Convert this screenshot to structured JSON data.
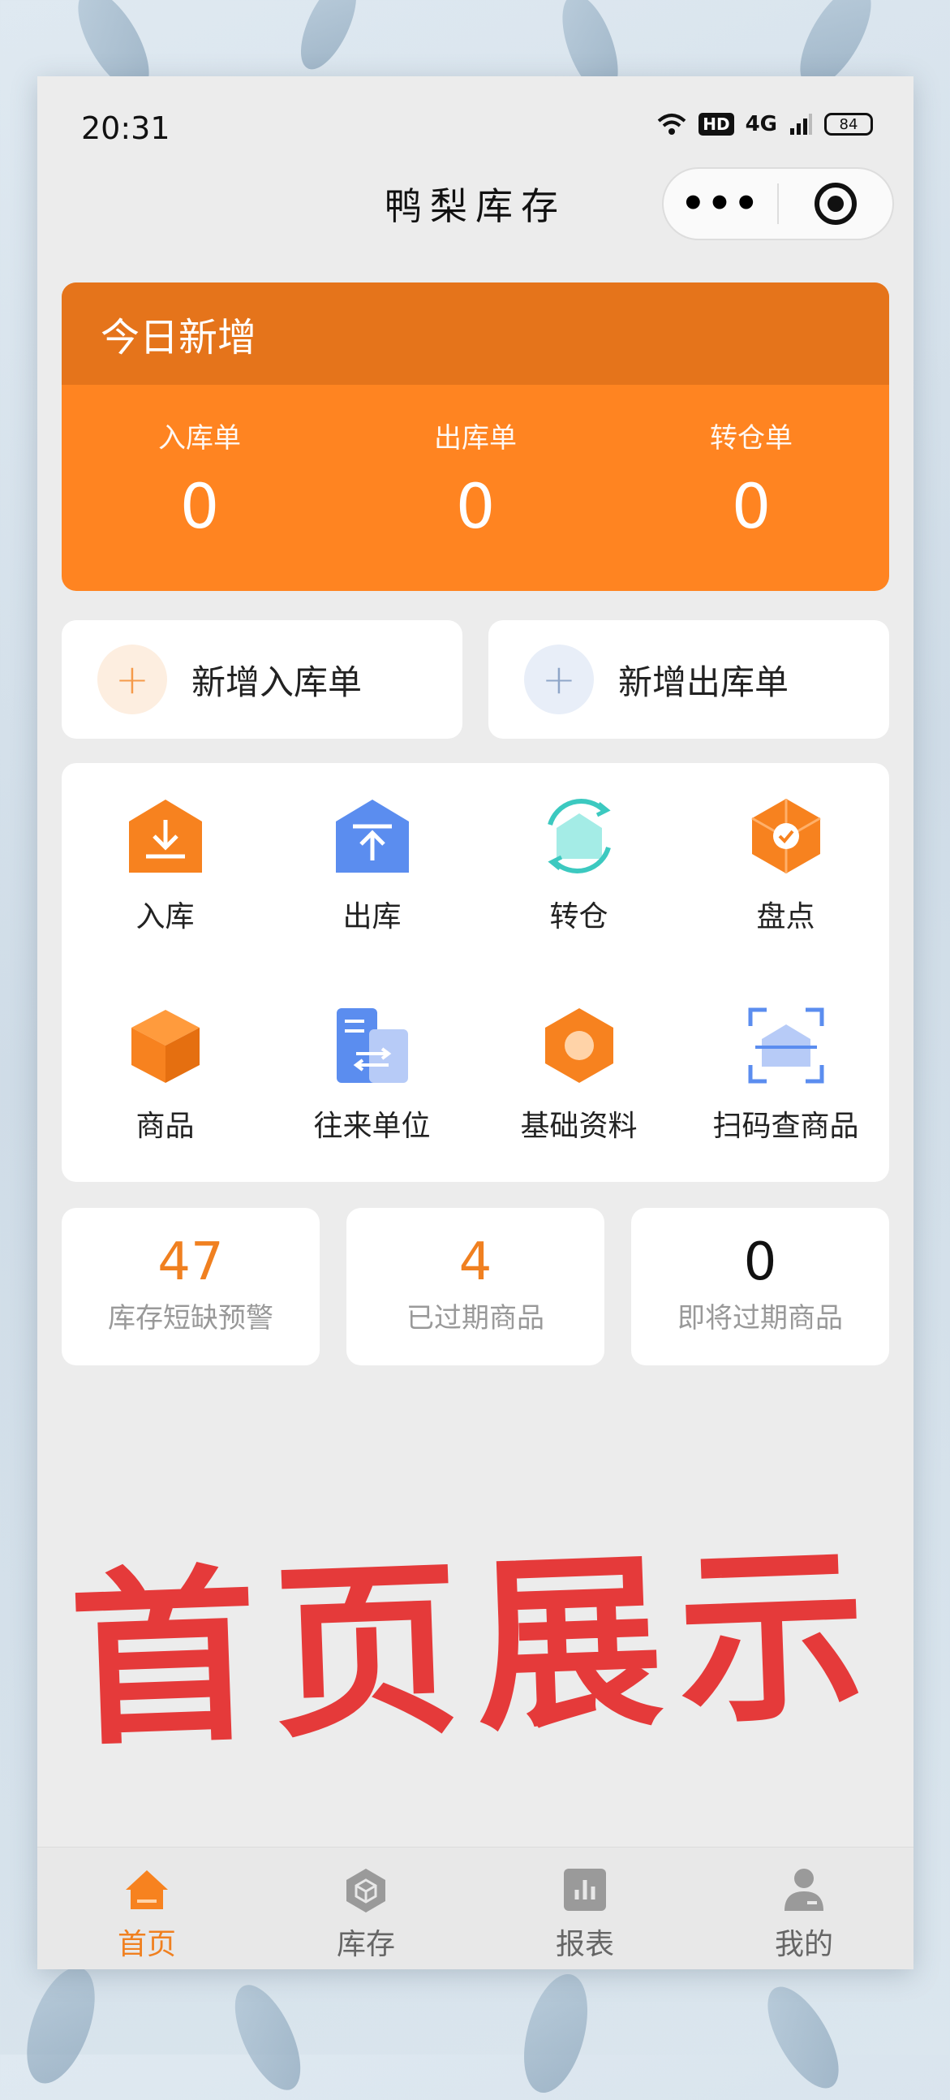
{
  "status_bar": {
    "time": "20:31",
    "hd": "HD",
    "signal": "4G",
    "battery": "84"
  },
  "nav": {
    "title": "鸭梨库存",
    "more_icon": "more-dots-icon",
    "close_icon": "target-icon"
  },
  "today": {
    "title": "今日新增",
    "stats": [
      {
        "label": "入库单",
        "value": "0"
      },
      {
        "label": "出库单",
        "value": "0"
      },
      {
        "label": "转仓单",
        "value": "0"
      }
    ]
  },
  "quick_actions": [
    {
      "label": "新增入库单",
      "icon": "plus-icon",
      "color": "#f59a4a",
      "bg": "#fdeee0"
    },
    {
      "label": "新增出库单",
      "icon": "plus-icon",
      "color": "#8fa6c8",
      "bg": "#e8eef8"
    }
  ],
  "grid": [
    {
      "label": "入库",
      "icon": "inbound-icon"
    },
    {
      "label": "出库",
      "icon": "outbound-icon"
    },
    {
      "label": "转仓",
      "icon": "transfer-icon"
    },
    {
      "label": "盘点",
      "icon": "stocktake-icon"
    },
    {
      "label": "商品",
      "icon": "box-icon"
    },
    {
      "label": "往来单位",
      "icon": "partner-icon"
    },
    {
      "label": "基础资料",
      "icon": "hexagon-icon"
    },
    {
      "label": "扫码查商品",
      "icon": "scan-icon"
    }
  ],
  "metrics": [
    {
      "value": "47",
      "label": "库存短缺预警",
      "color": "#f08020"
    },
    {
      "value": "4",
      "label": "已过期商品",
      "color": "#f08020"
    },
    {
      "value": "0",
      "label": "即将过期商品",
      "color": "#111111"
    }
  ],
  "banner": "首页展示",
  "tabs": [
    {
      "label": "首页",
      "icon": "home-icon",
      "active": true
    },
    {
      "label": "库存",
      "icon": "cube-icon",
      "active": false
    },
    {
      "label": "报表",
      "icon": "chart-icon",
      "active": false
    },
    {
      "label": "我的",
      "icon": "user-icon",
      "active": false
    }
  ],
  "colors": {
    "orange": "#ff8421",
    "orange_dark": "#e5741b",
    "blue": "#5b8def",
    "teal": "#3cc9c0",
    "banner_red": "#e53a3a"
  }
}
